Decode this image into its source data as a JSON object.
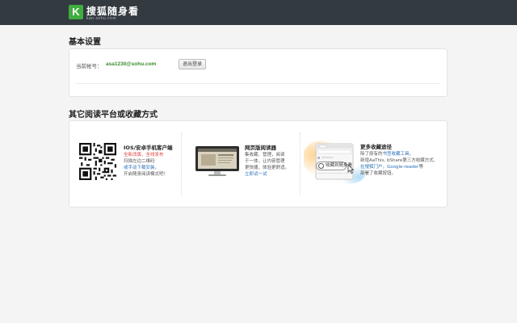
{
  "header": {
    "logo_letter": "K",
    "brand_name": "搜狐随身看",
    "brand_url": "kan.sohu.com"
  },
  "basic_settings": {
    "title": "基本设置",
    "account_label": "当前帐号：",
    "account_email": "asa1230@sohu.com",
    "logout_label": "退出登录"
  },
  "other_platforms": {
    "title": "其它阅读平台或收藏方式",
    "mobile": {
      "title": "IOS/安卓手机客户端",
      "line1": "全新改版，全线发布",
      "line2": "扫描左边二维码",
      "line3": "或手动下载安装，",
      "line4": "开启随身阅读模式吧！"
    },
    "web": {
      "title": "网页版阅读器",
      "line1": "集收藏、管理，阅读",
      "line2": "于一体，让内容管理",
      "line3": "更快捷，体验更舒适。",
      "link": "立即试一试"
    },
    "more": {
      "title": "更多收藏途径",
      "line1_pre": "除了原有的",
      "line1_link": "书签收藏工具",
      "line1_post": "，",
      "line2": "新增AaThis, bShare第三方收藏方式,",
      "line3_link": "在搜狐门户",
      "line3_mid": "，",
      "line3_link2": "Google-reader",
      "line3_post": "等",
      "line4": "部署了收藏按钮。",
      "button_label": "收藏到随身看"
    }
  },
  "colors": {
    "topbar": "#333a40",
    "brand_green": "#3fae3f",
    "email_green": "#3a8c2c",
    "highlight_red": "#e0443d",
    "link_blue": "#2a6fb8"
  }
}
